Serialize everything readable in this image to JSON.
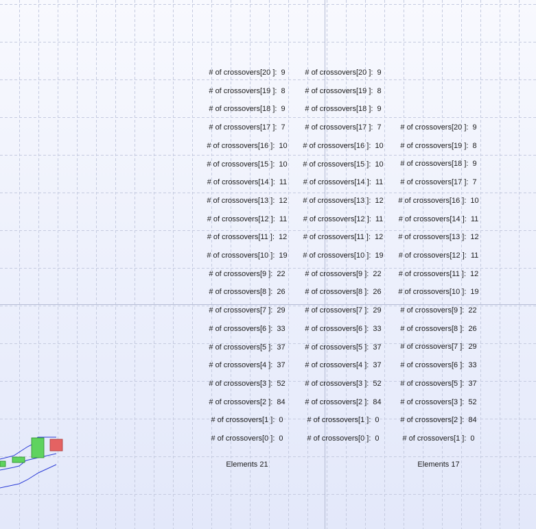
{
  "label_prefix": "# of crossovers",
  "columns": [
    {
      "rows": [
        {
          "index": "20",
          "value": "9"
        },
        {
          "index": "19",
          "value": "8"
        },
        {
          "index": "18",
          "value": "9"
        },
        {
          "index": "17",
          "value": "7"
        },
        {
          "index": "16",
          "value": "10"
        },
        {
          "index": "15",
          "value": "10"
        },
        {
          "index": "14",
          "value": "11"
        },
        {
          "index": "13",
          "value": "12"
        },
        {
          "index": "12",
          "value": "11"
        },
        {
          "index": "11",
          "value": "12"
        },
        {
          "index": "10",
          "value": "19"
        },
        {
          "index": "9",
          "value": "22"
        },
        {
          "index": "8",
          "value": "26"
        },
        {
          "index": "7",
          "value": "29"
        },
        {
          "index": "6",
          "value": "33"
        },
        {
          "index": "5",
          "value": "37"
        },
        {
          "index": "4",
          "value": "37"
        },
        {
          "index": "3",
          "value": "52"
        },
        {
          "index": "2",
          "value": "84"
        },
        {
          "index": "1",
          "value": "0"
        },
        {
          "index": "0",
          "value": "0"
        }
      ],
      "footer": "Elements 21"
    },
    {
      "rows": [
        {
          "index": "20",
          "value": "9"
        },
        {
          "index": "19",
          "value": "8"
        },
        {
          "index": "18",
          "value": "9"
        },
        {
          "index": "17",
          "value": "7"
        },
        {
          "index": "16",
          "value": "10"
        },
        {
          "index": "15",
          "value": "10"
        },
        {
          "index": "14",
          "value": "11"
        },
        {
          "index": "13",
          "value": "12"
        },
        {
          "index": "12",
          "value": "11"
        },
        {
          "index": "11",
          "value": "12"
        },
        {
          "index": "10",
          "value": "19"
        },
        {
          "index": "9",
          "value": "22"
        },
        {
          "index": "8",
          "value": "26"
        },
        {
          "index": "7",
          "value": "29"
        },
        {
          "index": "6",
          "value": "33"
        },
        {
          "index": "5",
          "value": "37"
        },
        {
          "index": "4",
          "value": "37"
        },
        {
          "index": "3",
          "value": "52"
        },
        {
          "index": "2",
          "value": "84"
        },
        {
          "index": "1",
          "value": "0"
        },
        {
          "index": "0",
          "value": "0"
        }
      ],
      "footer": ""
    },
    {
      "rows": [
        {
          "index": "20",
          "value": "9"
        },
        {
          "index": "19",
          "value": "8"
        },
        {
          "index": "18",
          "value": "9"
        },
        {
          "index": "17",
          "value": "7"
        },
        {
          "index": "16",
          "value": "10"
        },
        {
          "index": "14",
          "value": "11"
        },
        {
          "index": "13",
          "value": "12"
        },
        {
          "index": "12",
          "value": "11"
        },
        {
          "index": "11",
          "value": "12"
        },
        {
          "index": "10",
          "value": "19"
        },
        {
          "index": "9",
          "value": "22"
        },
        {
          "index": "8",
          "value": "26"
        },
        {
          "index": "7",
          "value": "29"
        },
        {
          "index": "6",
          "value": "33"
        },
        {
          "index": "5",
          "value": "37"
        },
        {
          "index": "3",
          "value": "52"
        },
        {
          "index": "2",
          "value": "84"
        },
        {
          "index": "1",
          "value": "0"
        }
      ],
      "footer": "Elements 17"
    }
  ],
  "colors": {
    "grid": "#c5cbe0",
    "crosshair": "#b4bbd4",
    "candle_up": "#5fd35f",
    "candle_down": "#e46262",
    "band_line": "#2a3bd6"
  }
}
